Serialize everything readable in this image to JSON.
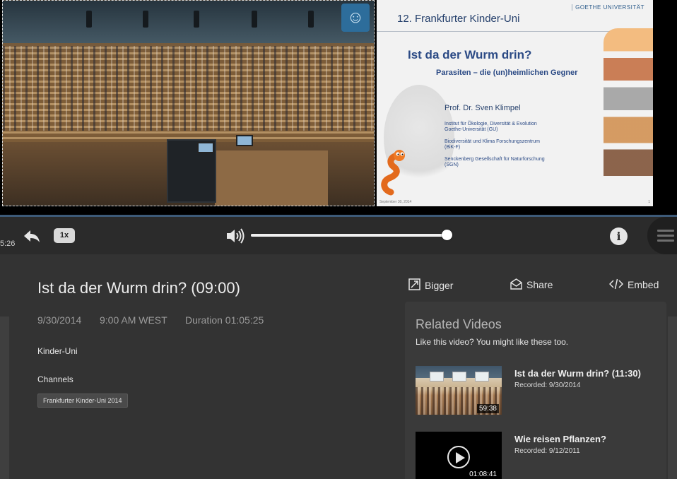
{
  "player": {
    "time_fragment": "5:26",
    "speed_label": "1x",
    "volume_level": 0.99,
    "info_label": "i"
  },
  "slide": {
    "header": "12. Frankfurter Kinder-Uni",
    "university": "GOETHE UNIVERSITÄT",
    "title": "Ist da der Wurm drin?",
    "subtitle": "Parasiten – die (un)heimlichen Gegner",
    "presenter": "Prof. Dr. Sven Klimpel",
    "affiliations": [
      "Institut für Ökologie, Diversität & Evolution\nGoethe-Universität (GU)",
      "Biodiversität und Klima Forschungszentrum\n(BiK-F)",
      "Senckenberg Gesellschaft für Naturforschung\n(SGN)"
    ],
    "footer_date": "September 30, 2014",
    "footer_page": "1"
  },
  "video": {
    "title": "Ist da der Wurm drin? (09:00)",
    "date": "9/30/2014",
    "time": "9:00 AM WEST",
    "duration": "Duration 01:05:25",
    "category": "Kinder-Uni",
    "channels_label": "Channels",
    "channel_tag": "Frankfurter Kinder-Uni 2014"
  },
  "actions": {
    "bigger": "Bigger",
    "share": "Share",
    "embed": "Embed"
  },
  "related": {
    "title": "Related Videos",
    "subtitle": "Like this video? You might like these too.",
    "items": [
      {
        "title": "Ist da der Wurm drin? (11:30)",
        "recorded": "Recorded: 9/30/2014",
        "duration": "59:38",
        "thumb": "lecture-hall"
      },
      {
        "title": "Wie reisen Pflanzen?",
        "recorded": "Recorded: 9/12/2011",
        "duration": "01:08:41",
        "thumb": "play-icon"
      }
    ]
  },
  "colors": {
    "page_bg": "#333333",
    "controls_bg": "#2b2b2b",
    "slide_blue": "#2b4a85",
    "progress_line": "#3d5a78"
  }
}
